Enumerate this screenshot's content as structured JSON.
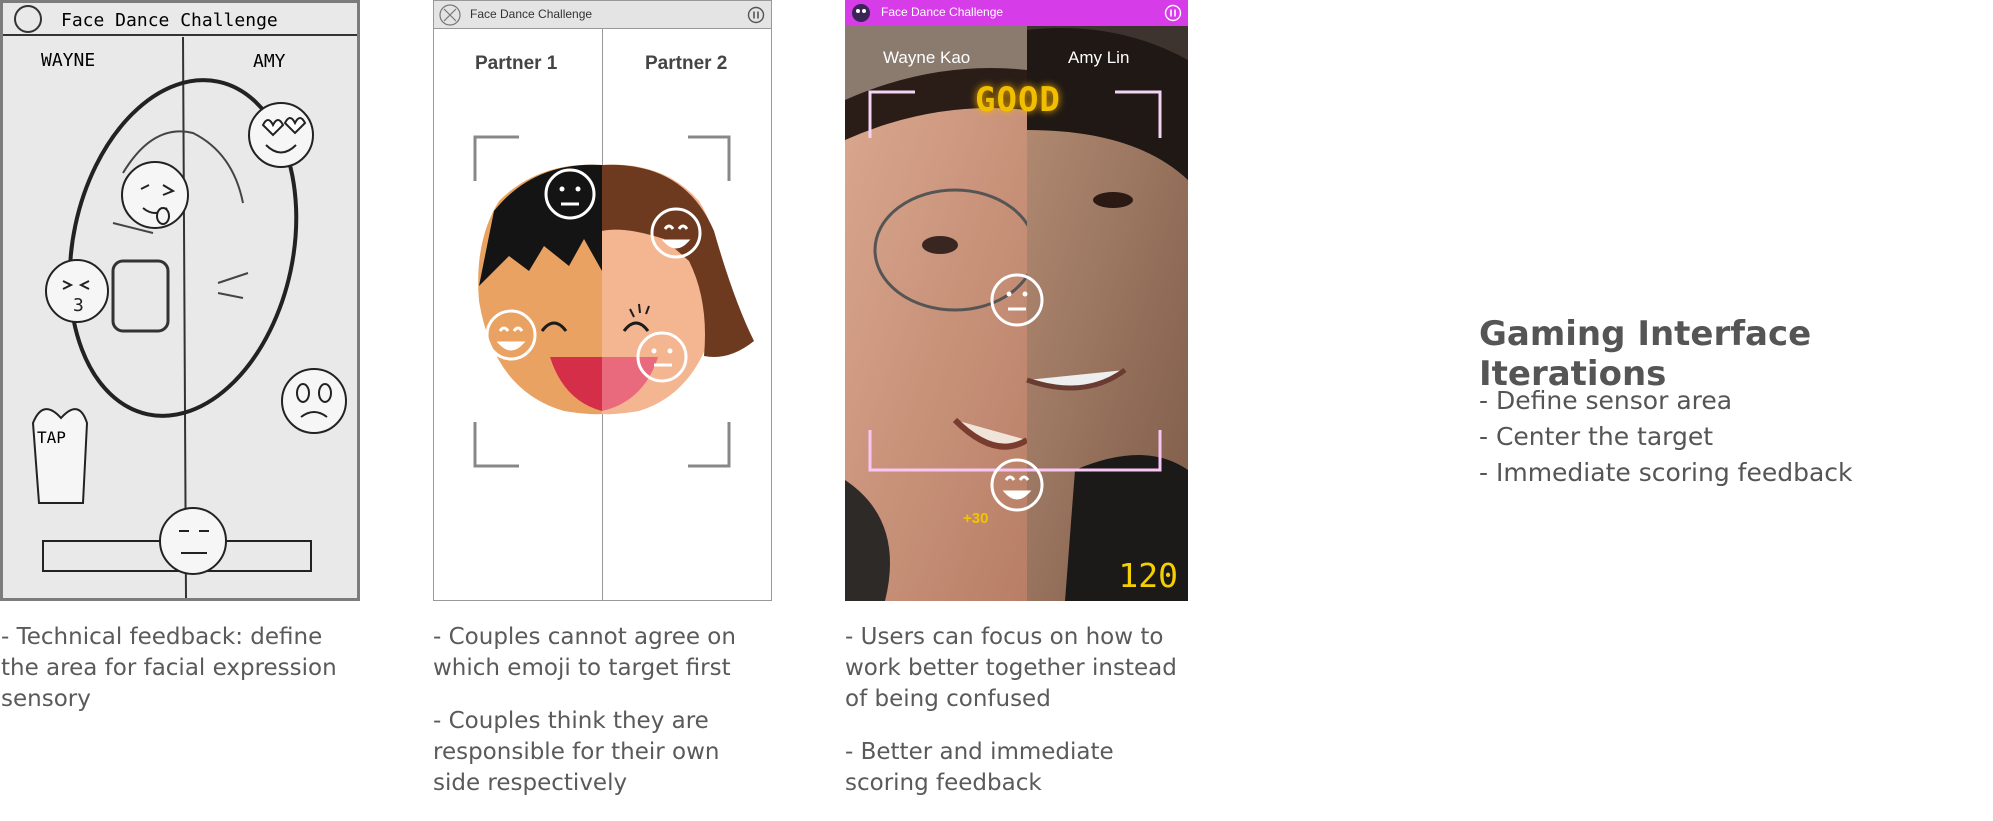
{
  "sketch": {
    "title": "Face Dance Challenge",
    "left_name": "WAYNE",
    "right_name": "AMY",
    "tap_label": "TAP",
    "caption": [
      "- Technical feedback: define the area for facial expression sensory"
    ]
  },
  "wireframe": {
    "title": "Face Dance Challenge",
    "partner1": "Partner 1",
    "partner2": "Partner 2",
    "captions": [
      "- Couples cannot agree on which emoji to target first",
      "- Couples think they are responsible for their own side respectively"
    ]
  },
  "photo": {
    "title": "Face Dance Challenge",
    "left_name": "Wayne Kao",
    "right_name": "Amy Lin",
    "feedback": "GOOD",
    "bonus": "+30",
    "score": "120",
    "bar_color": "#d63ce8",
    "captions": [
      "- Users can focus on how to work better together instead of being confused",
      "- Better and immediate scoring feedback"
    ]
  },
  "summary": {
    "heading": "Gaming Interface Iterations",
    "bullets": [
      "- Define sensor area",
      "- Center the target",
      "- Immediate scoring feedback"
    ]
  }
}
